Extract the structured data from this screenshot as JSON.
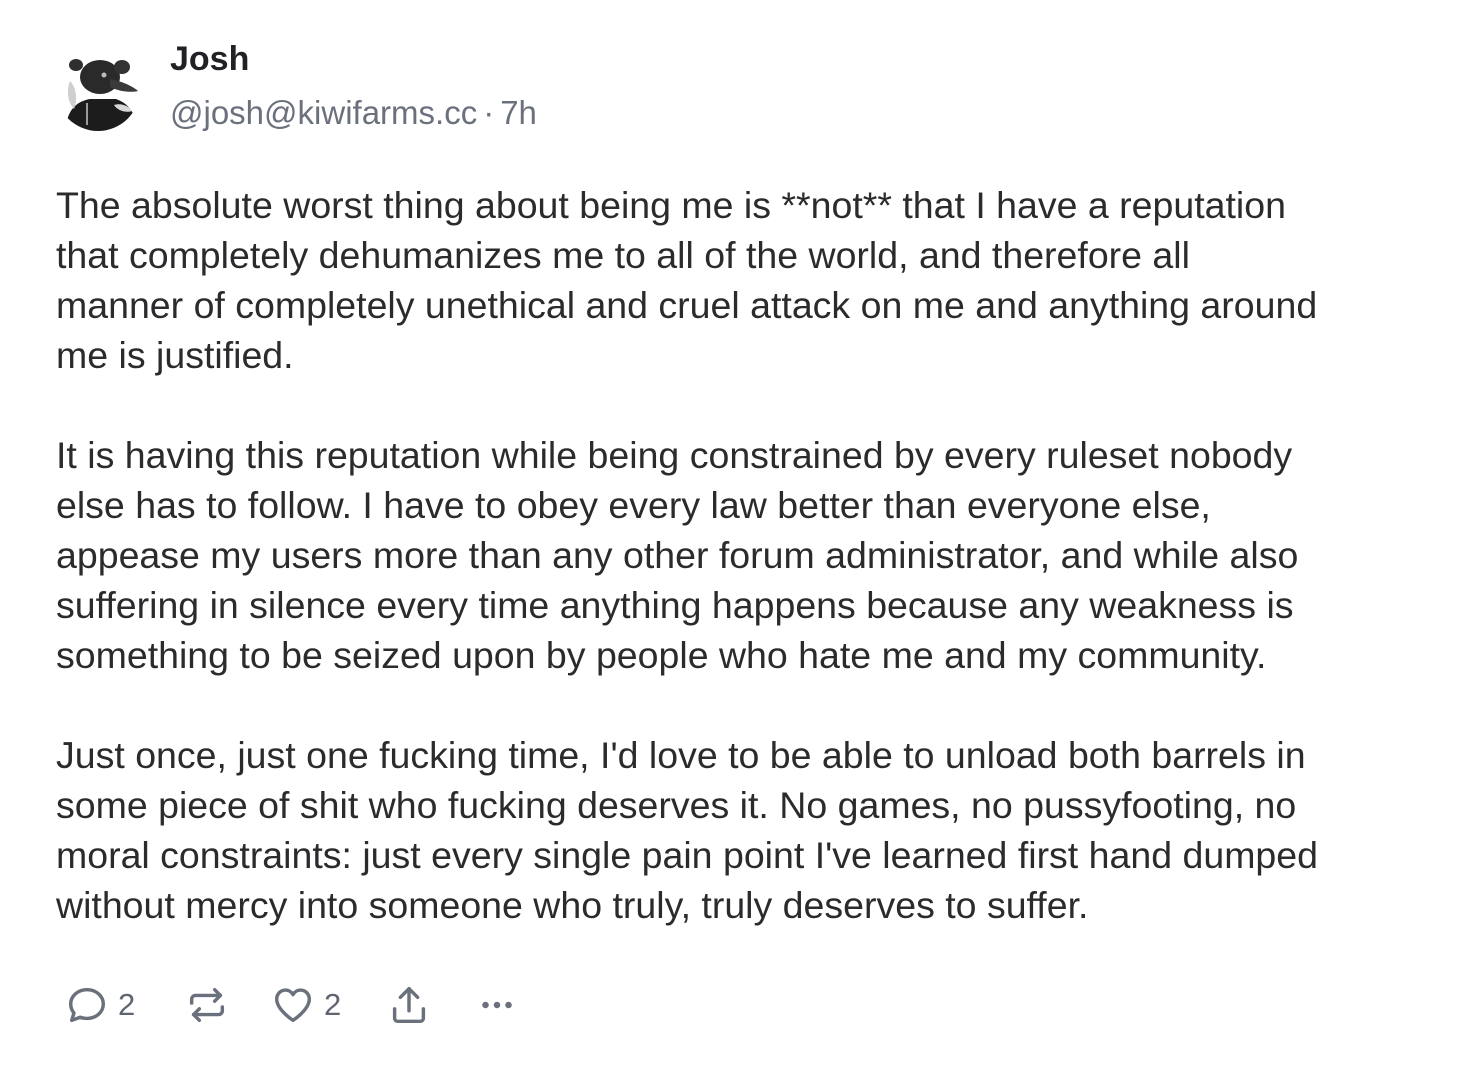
{
  "author": {
    "name": "Josh",
    "handle": "@josh@kiwifarms.cc",
    "separator": "·",
    "time": "7h",
    "avatar_icon": "avatar-photo"
  },
  "post": {
    "paragraphs": [
      "The absolute worst thing about being me is **not** that I have a reputation\nthat completely dehumanizes me to all of the world, and therefore all\nmanner of completely unethical and cruel attack on me and anything around\nme is justified.",
      "It is having this reputation while being constrained by every ruleset nobody\nelse has to follow. I have to obey every law better than everyone else,\nappease my users more than any other forum administrator, and while also\nsuffering in silence every time anything happens because any weakness is\nsomething to be seized upon by people who hate me and my community.",
      "Just once, just one fucking time, I'd love to be able to unload both barrels in\nsome piece of shit who fucking deserves it. No games, no pussyfooting, no\nmoral constraints: just every single pain point I've learned first hand dumped\nwithout mercy into someone who truly, truly deserves to suffer."
    ]
  },
  "actions": {
    "replies": {
      "icon": "reply-icon",
      "count": "2"
    },
    "repost": {
      "icon": "repost-icon"
    },
    "likes": {
      "icon": "heart-icon",
      "count": "2"
    },
    "share": {
      "icon": "share-icon"
    },
    "more": {
      "icon": "more-icon"
    }
  },
  "colors": {
    "text": "#2b2b2e",
    "muted": "#6b717c",
    "background": "#ffffff"
  }
}
